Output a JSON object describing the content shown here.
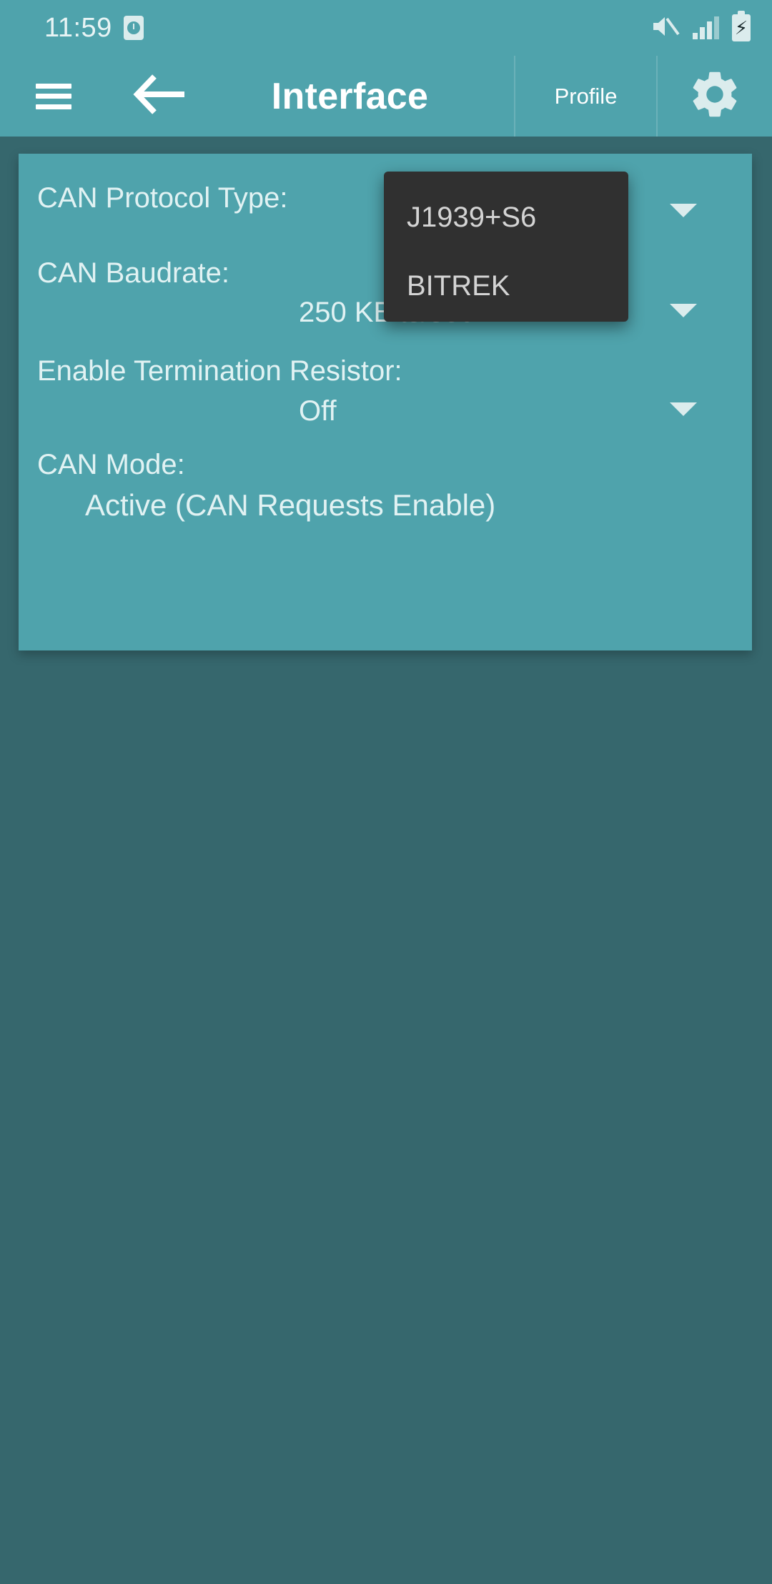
{
  "status_bar": {
    "time": "11:59",
    "alarm_icon": "alarm-clock-icon",
    "mute_icon": "volume-mute-icon",
    "signal_icon": "cellular-signal-icon",
    "battery_icon": "battery-charging-icon"
  },
  "app_bar": {
    "menu_icon": "hamburger-menu-icon",
    "back_icon": "arrow-left-icon",
    "title": "Interface",
    "profile_label": "Profile",
    "settings_icon": "gear-icon"
  },
  "settings": {
    "fields": [
      {
        "label": "CAN Protocol Type:",
        "value": "J1939+S6",
        "caret": "chevron-down-icon"
      },
      {
        "label": "CAN Baudrate:",
        "value": "250 KBits/sec",
        "caret": "chevron-down-icon"
      },
      {
        "label": "Enable Termination Resistor:",
        "value": "Off",
        "caret": "chevron-down-icon"
      },
      {
        "label": "CAN Mode:",
        "value": "Active (CAN Requests Enable)",
        "caret": ""
      }
    ]
  },
  "dropdown": {
    "open_for": "CAN Protocol Type:",
    "options": [
      "J1939+S6",
      "BITREK"
    ],
    "selected": "J1939+S6"
  },
  "colors": {
    "page_background": "#36676d",
    "card_background": "#4fa3ac",
    "app_bar": "#4fa3ac",
    "dropdown_background": "#303030",
    "primary_text": "#ffffff",
    "secondary_text": "#e1f2f3",
    "dropdown_text": "#d4d4d4"
  }
}
